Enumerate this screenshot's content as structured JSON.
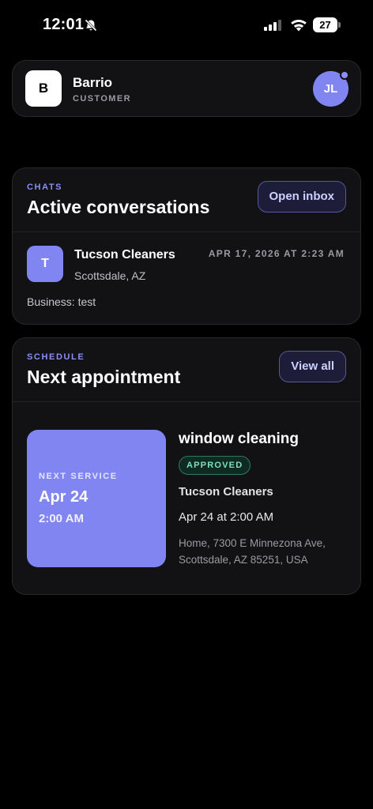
{
  "status_bar": {
    "time": "12:01",
    "battery": "27"
  },
  "header": {
    "logo_letter": "B",
    "app_name": "Barrio",
    "role": "CUSTOMER",
    "avatar_initials": "JL"
  },
  "chats": {
    "section_label": "CHATS",
    "title": "Active conversations",
    "button_label": "Open inbox",
    "conversation": {
      "avatar_letter": "T",
      "name": "Tucson Cleaners",
      "location": "Scottsdale, AZ",
      "timestamp": "APR 17, 2026 AT 2:23 AM",
      "preview": "Business: test"
    }
  },
  "schedule": {
    "section_label": "SCHEDULE",
    "title": "Next appointment",
    "button_label": "View all",
    "tile": {
      "label": "NEXT SERVICE",
      "date": "Apr 24",
      "time": "2:00 AM"
    },
    "appointment": {
      "title": "window cleaning",
      "status": "APPROVED",
      "business": "Tucson Cleaners",
      "datetime": "Apr 24 at 2:00 AM",
      "address": "Home, 7300 E Minnezona Ave, Scottsdale, AZ 85251, USA"
    }
  },
  "colors": {
    "accent": "#8185f2",
    "background": "#000000",
    "card": "#121214",
    "approved": "#7fe0b8"
  },
  "icons": [
    "bell-slash-icon",
    "cellular-signal-icon",
    "wifi-icon",
    "battery-icon"
  ]
}
